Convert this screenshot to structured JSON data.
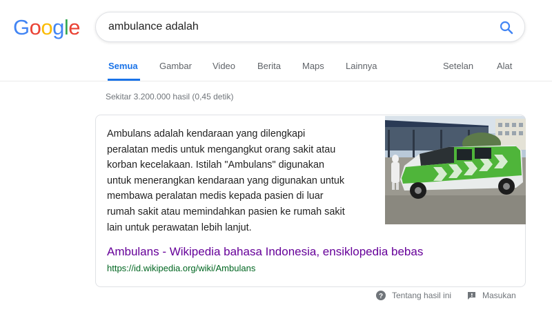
{
  "logo": {
    "letters": [
      "G",
      "o",
      "o",
      "g",
      "l",
      "e"
    ],
    "colors": [
      "#4285F4",
      "#EA4335",
      "#FBBC05",
      "#4285F4",
      "#34A853",
      "#EA4335"
    ]
  },
  "search": {
    "query": "ambulance adalah",
    "button_icon": "search-icon"
  },
  "tabs": [
    {
      "label": "Semua",
      "active": true
    },
    {
      "label": "Gambar"
    },
    {
      "label": "Video"
    },
    {
      "label": "Berita"
    },
    {
      "label": "Maps"
    },
    {
      "label": "Lainnya"
    },
    {
      "label": "Setelan"
    },
    {
      "label": "Alat"
    }
  ],
  "result_stats": "Sekitar 3.200.000 hasil (0,45 detik)",
  "featured_snippet": {
    "text_lines": [
      "Ambulans adalah kendaraan yang dilengkapi",
      "peralatan medis untuk mengangkut orang sakit atau",
      "korban kecelakaan. Istilah \"Ambulans\" digunakan",
      "untuk menerangkan kendaraan yang digunakan untuk",
      "membawa peralatan medis kepada pasien di luar",
      "rumah sakit atau memindahkan pasien ke rumah sakit",
      "lain untuk perawatan lebih lanjut."
    ],
    "title": "Ambulans - Wikipedia bahasa Indonesia, ensiklopedia bebas",
    "url": "https://id.wikipedia.org/wiki/Ambulans",
    "image_alt": "ambulance-photo"
  },
  "footer": {
    "about": "Tentang hasil ini",
    "feedback": "Masukan"
  },
  "colors": {
    "accent": "#1a73e8",
    "visited_link": "#660099",
    "url_green": "#006621"
  }
}
